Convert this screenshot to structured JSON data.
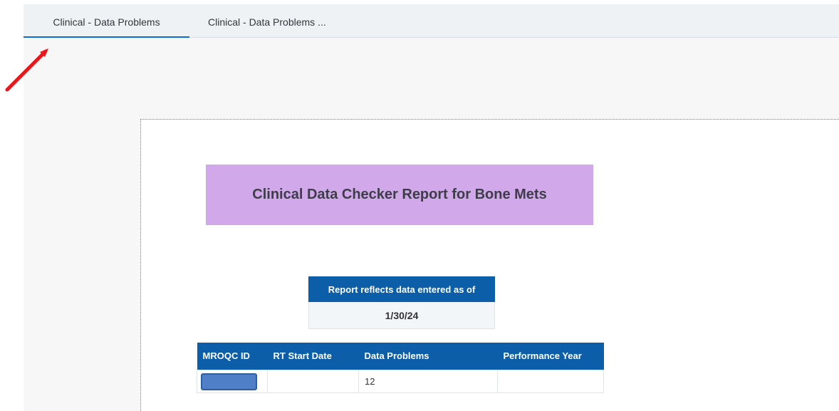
{
  "tabs": [
    {
      "label": "Clinical - Data Problems",
      "active": true
    },
    {
      "label": "Clinical - Data Problems ...",
      "active": false
    }
  ],
  "report": {
    "title": "Clinical Data Checker Report for Bone Mets",
    "asof_header": "Report reflects data entered as of",
    "asof_value": "1/30/24"
  },
  "table": {
    "headers": [
      "MROQC ID",
      "RT Start Date",
      "Data Problems",
      "Performance Year"
    ],
    "rows": [
      {
        "mroqc_id": "",
        "rt_start_date": "",
        "data_problems": "12",
        "performance_year": ""
      }
    ]
  },
  "colors": {
    "accent": "#0a6ed1",
    "header_blue": "#0c5ea8",
    "title_purple": "#d1a9eb",
    "annotation_red": "#e8171b"
  }
}
